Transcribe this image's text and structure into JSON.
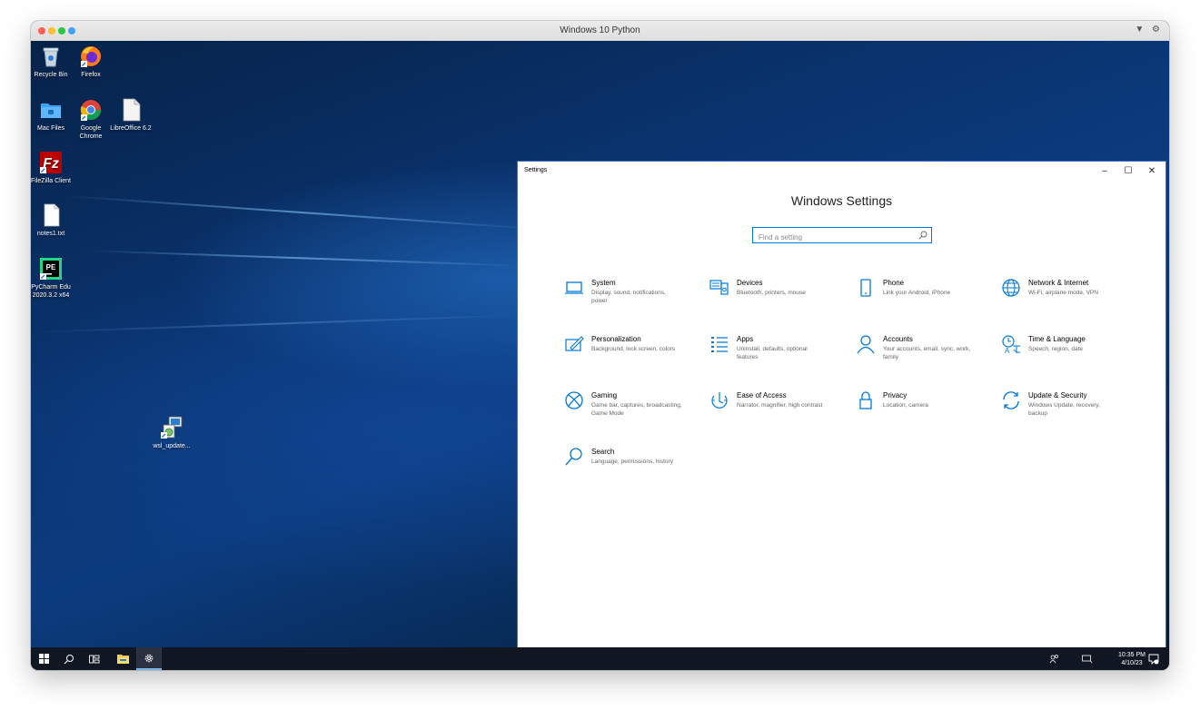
{
  "vm": {
    "title": "Windows 10 Python",
    "tools": [
      "▼",
      "⚙"
    ]
  },
  "desktop_icons": [
    {
      "name": "recycle-bin",
      "label": "Recycle Bin",
      "icon": "recycle-bin-icon"
    },
    {
      "name": "firefox",
      "label": "Firefox",
      "icon": "firefox-icon"
    },
    {
      "name": "mac-files",
      "label": "Mac Files",
      "icon": "folder-icon"
    },
    {
      "name": "google-chrome",
      "label": "Google Chrome",
      "icon": "chrome-icon"
    },
    {
      "name": "libreoffice",
      "label": "LibreOffice 6.2",
      "icon": "document-icon"
    },
    {
      "name": "filezilla",
      "label": "FileZilla Client",
      "icon": "filezilla-icon"
    },
    {
      "name": "notes",
      "label": "notes1.txt",
      "icon": "text-file-icon"
    },
    {
      "name": "pycharm",
      "label": "PyCharm Edu 2020.3.2 x64",
      "icon": "pycharm-icon"
    },
    {
      "name": "wsl-update",
      "label": "wsl_update...",
      "icon": "installer-icon"
    }
  ],
  "settings": {
    "window_title": "Settings",
    "controls": [
      "–",
      "☐",
      "✕"
    ],
    "heading": "Windows Settings",
    "search_placeholder": "Find a setting",
    "categories": [
      {
        "title": "System",
        "desc": "Display, sound, notifications, power",
        "icon": "laptop-icon"
      },
      {
        "title": "Devices",
        "desc": "Bluetooth, printers, mouse",
        "icon": "keyboard-speaker-icon"
      },
      {
        "title": "Phone",
        "desc": "Link your Android, iPhone",
        "icon": "phone-icon"
      },
      {
        "title": "Network & Internet",
        "desc": "Wi-Fi, airplane mode, VPN",
        "icon": "globe-icon"
      },
      {
        "title": "Personalization",
        "desc": "Background, lock screen, colors",
        "icon": "paint-pen-icon"
      },
      {
        "title": "Apps",
        "desc": "Uninstall, defaults, optional features",
        "icon": "app-list-icon"
      },
      {
        "title": "Accounts",
        "desc": "Your accounts, email, sync, work, family",
        "icon": "person-icon"
      },
      {
        "title": "Time & Language",
        "desc": "Speech, region, date",
        "icon": "time-language-icon"
      },
      {
        "title": "Gaming",
        "desc": "Game bar, captures, broadcasting, Game Mode",
        "icon": "xbox-icon"
      },
      {
        "title": "Ease of Access",
        "desc": "Narrator, magnifier, high contrast",
        "icon": "ease-of-access-icon"
      },
      {
        "title": "Privacy",
        "desc": "Location, camera",
        "icon": "lock-icon"
      },
      {
        "title": "Update & Security",
        "desc": "Windows Update, recovery, backup",
        "icon": "sync-arrows-icon"
      },
      {
        "title": "Search",
        "desc": "Language, permissions, history",
        "icon": "search-icon"
      }
    ]
  },
  "taskbar": {
    "items": [
      "windows-start-icon",
      "search-icon",
      "task-view-icon",
      "file-explorer-icon",
      "settings-gear-icon"
    ],
    "time": "10:35 PM",
    "date": "4/10/23"
  },
  "colors": {
    "accent": "#0078d7",
    "taskbar": "#101722",
    "desktop_blue": "#0c3c80"
  }
}
